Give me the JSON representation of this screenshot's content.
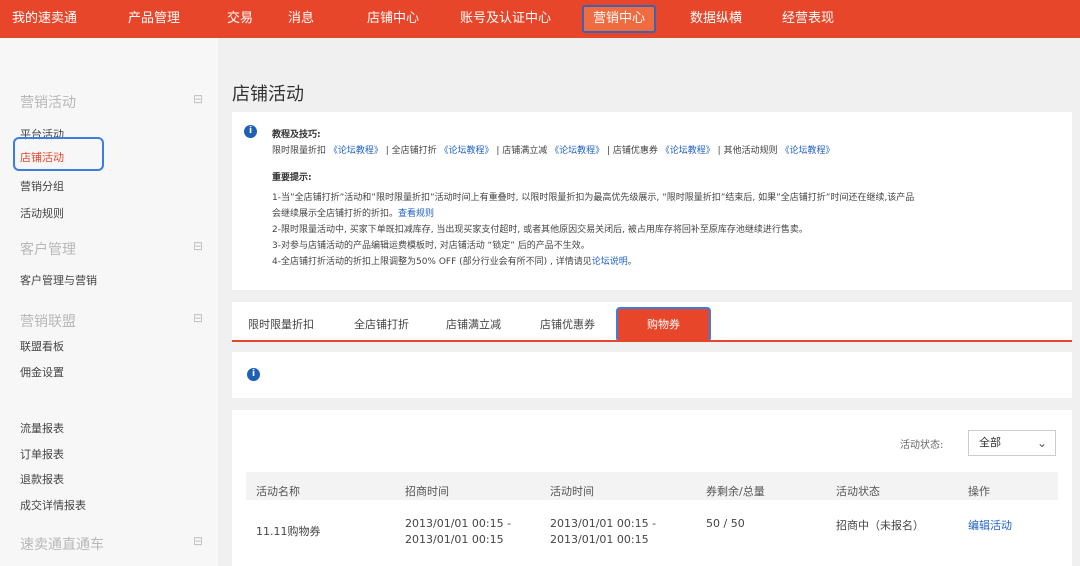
{
  "nav": {
    "items": [
      "我的速卖通",
      "产品管理",
      "交易",
      "消息",
      "店铺中心",
      "账号及认证中心",
      "营销中心",
      "数据纵横",
      "经营表现"
    ],
    "active": "营销中心"
  },
  "sidebar": {
    "groups": {
      "marketing": {
        "title": "营销活动",
        "items": [
          "平台活动",
          "店铺活动",
          "营销分组",
          "活动规则"
        ]
      },
      "customer": {
        "title": "客户管理",
        "items": [
          "客户管理与营销"
        ]
      },
      "affiliate": {
        "title": "营销联盟",
        "items": [
          "联盟看板",
          "佣金设置"
        ]
      },
      "reports": {
        "items": [
          "流量报表",
          "订单报表",
          "退款报表",
          "成交详情报表"
        ]
      },
      "express": {
        "title": "速卖通直通车"
      }
    },
    "collapse_symbol": "⊟",
    "current_item": "店铺活动"
  },
  "page": {
    "title": "店铺活动"
  },
  "tips": {
    "heading": "教程及技巧:",
    "line1": [
      {
        "t": "限时限量折扣 "
      },
      {
        "t": "《论坛教程》",
        "link": true
      },
      {
        "t": " | 全店铺打折 "
      },
      {
        "t": "《论坛教程》",
        "link": true
      },
      {
        "t": " | 店铺满立减 "
      },
      {
        "t": "《论坛教程》",
        "link": true
      },
      {
        "t": " | 店铺优惠券 "
      },
      {
        "t": "《论坛教程》",
        "link": true
      },
      {
        "t": " | 其他活动规则 "
      },
      {
        "t": "《论坛教程》",
        "link": true
      }
    ],
    "important_heading": "重要提示:",
    "notes": {
      "n1": "1-当”全店铺打折”活动和”限时限量折扣”活动时间上有重叠时, 以限时限量折扣为最高优先级展示, ”限时限量折扣”结束后, 如果”全店铺打折”时间还在继续,该产品",
      "n1b": "会继续展示全店铺打折的折扣。",
      "n1b_link": "查看规则",
      "n2": "2-限时限量活动中, 买家下单既扣减库存, 当出现买家支付超时, 或者其他原因交易关闭后, 被占用库存将回补至原库存池继续进行售卖。",
      "n3": "3-对参与店铺活动的产品编辑运费模板时, 对店铺活动 “锁定” 后的产品不生效。",
      "n4": "4-全店铺打折活动的折扣上限调整为50% OFF (部分行业会有所不同) , 详情请见",
      "n4_link": "论坛说明",
      "n4_end": "。"
    }
  },
  "tabs": [
    "限时限量折扣",
    "全店铺打折",
    "店铺满立减",
    "店铺优惠券",
    "购物券"
  ],
  "active_tab": "购物券",
  "info_icon": "i",
  "filter": {
    "label": "活动状态:",
    "value": "全部",
    "chevron": "⌄"
  },
  "table": {
    "headers": [
      "活动名称",
      "招商时间",
      "活动时间",
      "券剩余/总量",
      "活动状态",
      "操作"
    ],
    "rows": [
      {
        "name": "11.11购物券",
        "recruit_line1": "2013/01/01 00:15 -",
        "recruit_line2": "2013/01/01 00:15",
        "activity_line1": "2013/01/01 00:15 -",
        "activity_line2": "2013/01/01 00:15",
        "coupons": "50 / 50",
        "status": "招商中（未报名）",
        "action": "编辑活动"
      }
    ]
  },
  "colors": {
    "brand": "#e8462a",
    "link": "#1f62c8",
    "highlight_outline": "#3b7de0"
  }
}
